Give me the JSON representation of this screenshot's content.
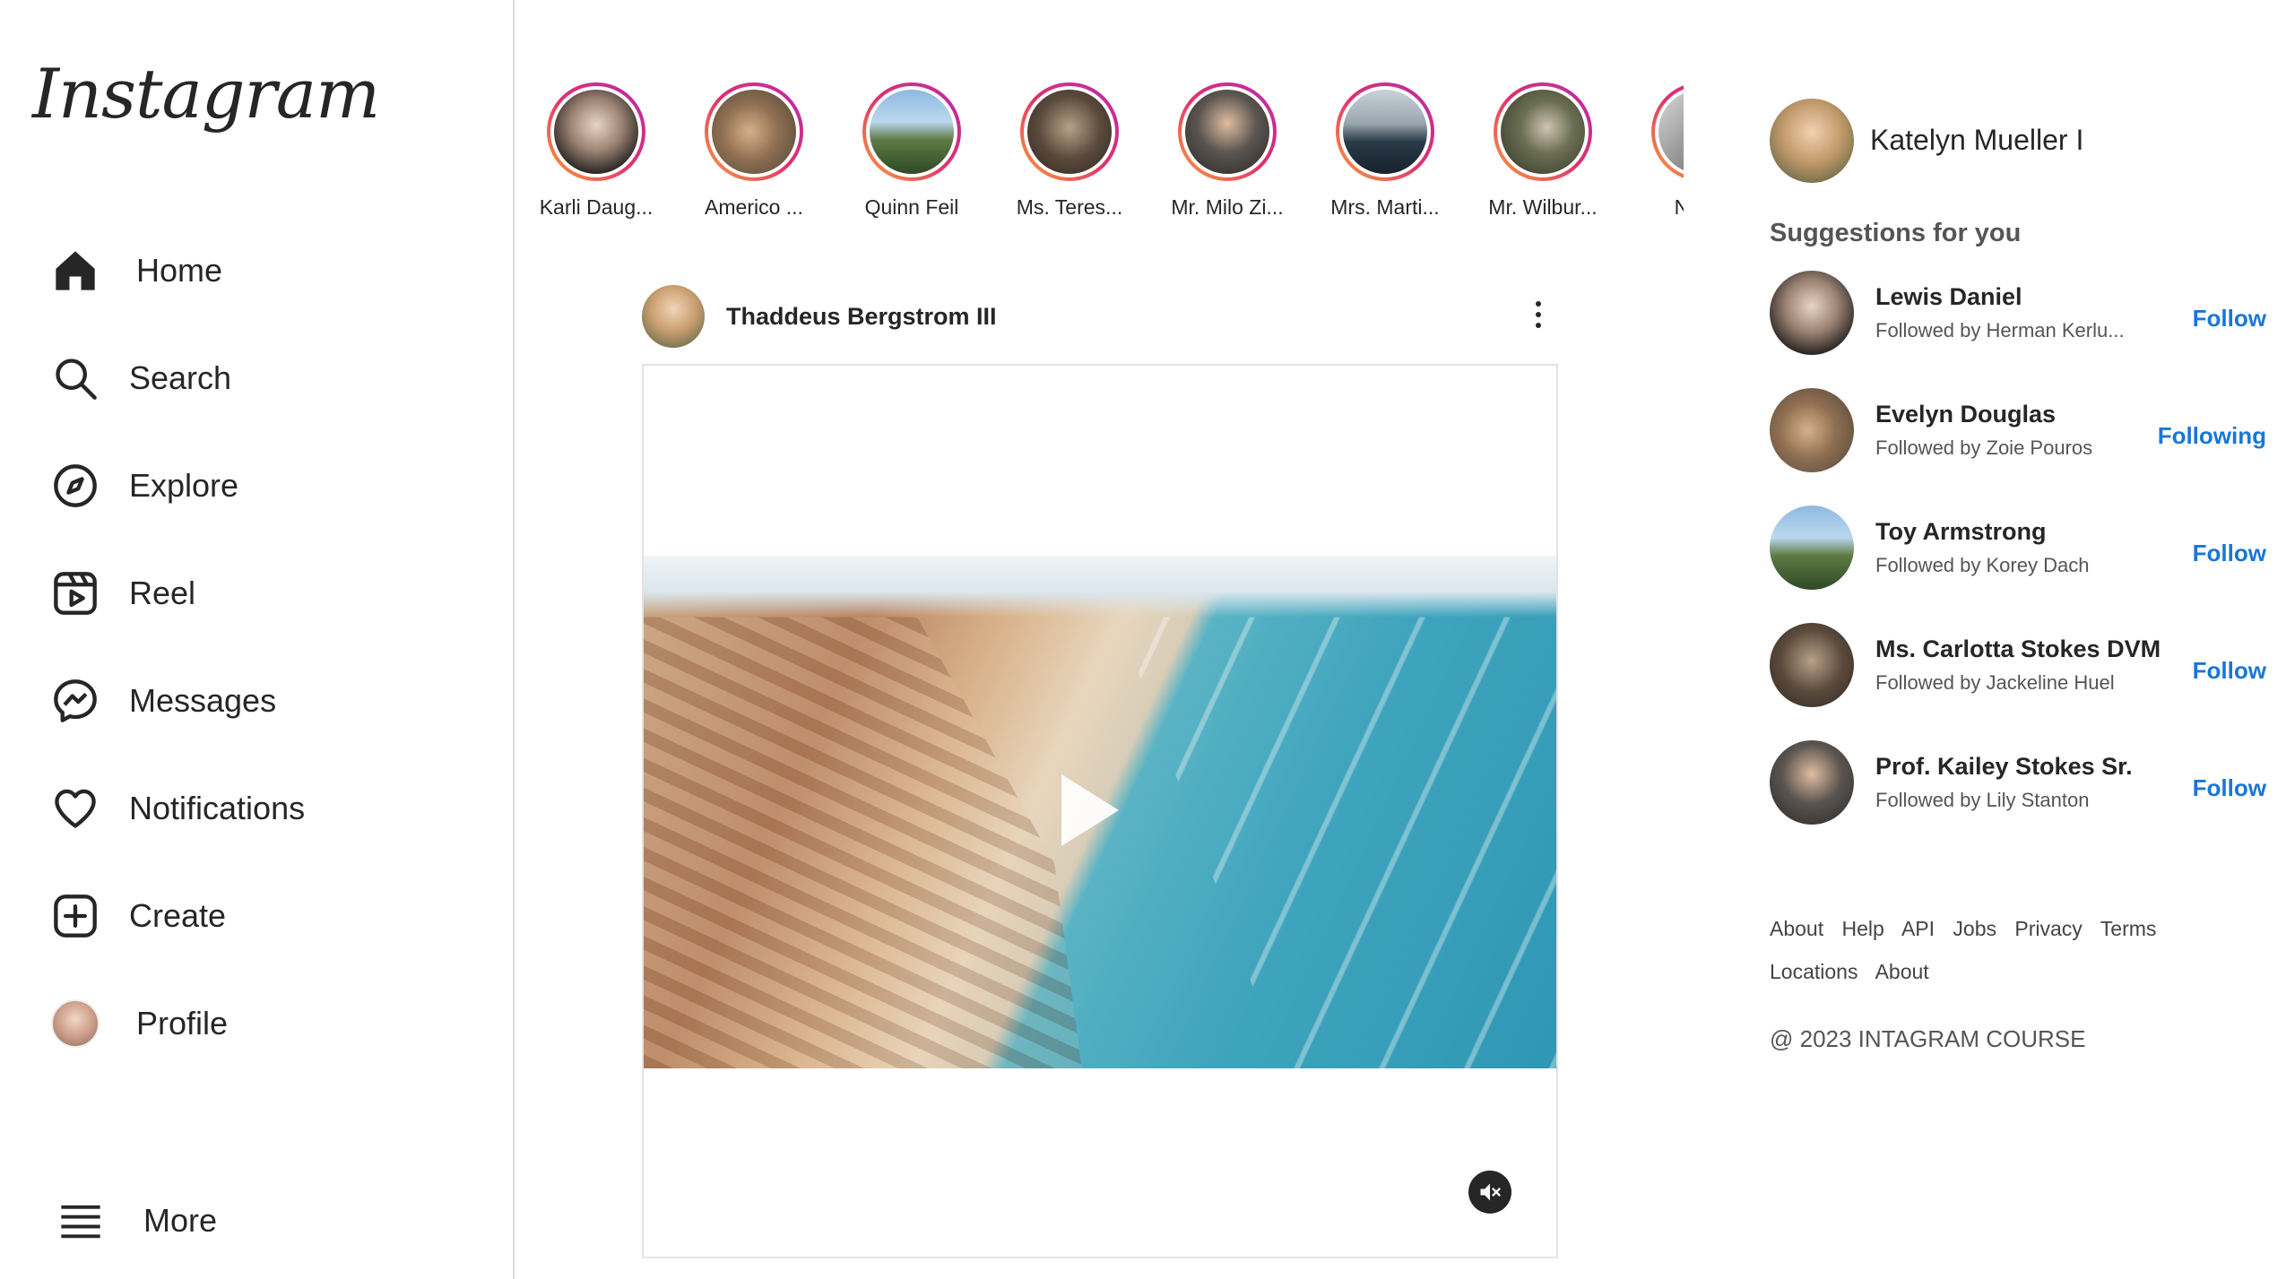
{
  "app": {
    "logo_text": "Instagram"
  },
  "sidebar": {
    "items": [
      {
        "label": "Home",
        "icon": "home-icon"
      },
      {
        "label": "Search",
        "icon": "search-icon"
      },
      {
        "label": "Explore",
        "icon": "compass-icon"
      },
      {
        "label": "Reel",
        "icon": "reel-icon"
      },
      {
        "label": "Messages",
        "icon": "messenger-icon"
      },
      {
        "label": "Notifications",
        "icon": "heart-icon"
      },
      {
        "label": "Create",
        "icon": "plus-square-icon"
      },
      {
        "label": "Profile",
        "icon": "avatar"
      }
    ],
    "more_label": "More"
  },
  "stories": [
    {
      "name": "Karli Daug..."
    },
    {
      "name": "Americo ..."
    },
    {
      "name": "Quinn Feil"
    },
    {
      "name": "Ms. Teres..."
    },
    {
      "name": "Mr. Milo Zi..."
    },
    {
      "name": "Mrs. Marti..."
    },
    {
      "name": "Mr. Wilbur..."
    },
    {
      "name": "Nakia"
    }
  ],
  "post": {
    "username": "Thaddeus Bergstrom III",
    "media_type": "video",
    "muted": true
  },
  "current_user": {
    "name": "Katelyn Mueller I"
  },
  "suggestions": {
    "title": "Suggestions for you",
    "items": [
      {
        "name": "Lewis Daniel",
        "sub": "Followed by Herman Kerlu...",
        "action": "Follow"
      },
      {
        "name": "Evelyn Douglas",
        "sub": "Followed by Zoie Pouros",
        "action": "Following"
      },
      {
        "name": "Toy Armstrong",
        "sub": "Followed by Korey Dach",
        "action": "Follow"
      },
      {
        "name": "Ms. Carlotta Stokes DVM",
        "sub": "Followed by Jackeline Huel",
        "action": "Follow"
      },
      {
        "name": "Prof. Kailey Stokes Sr.",
        "sub": "Followed by Lily Stanton",
        "action": "Follow"
      }
    ]
  },
  "footer": {
    "links": [
      "About",
      "Help",
      "API",
      "Jobs",
      "Privacy",
      "Terms",
      "Locations",
      "About"
    ],
    "copyright": "@ 2023 INTAGRAM COURSE"
  },
  "colors": {
    "accent": "#1877d8",
    "story_ring_start": "#f9a23c",
    "story_ring_end": "#b72bb0",
    "text": "#262626"
  }
}
